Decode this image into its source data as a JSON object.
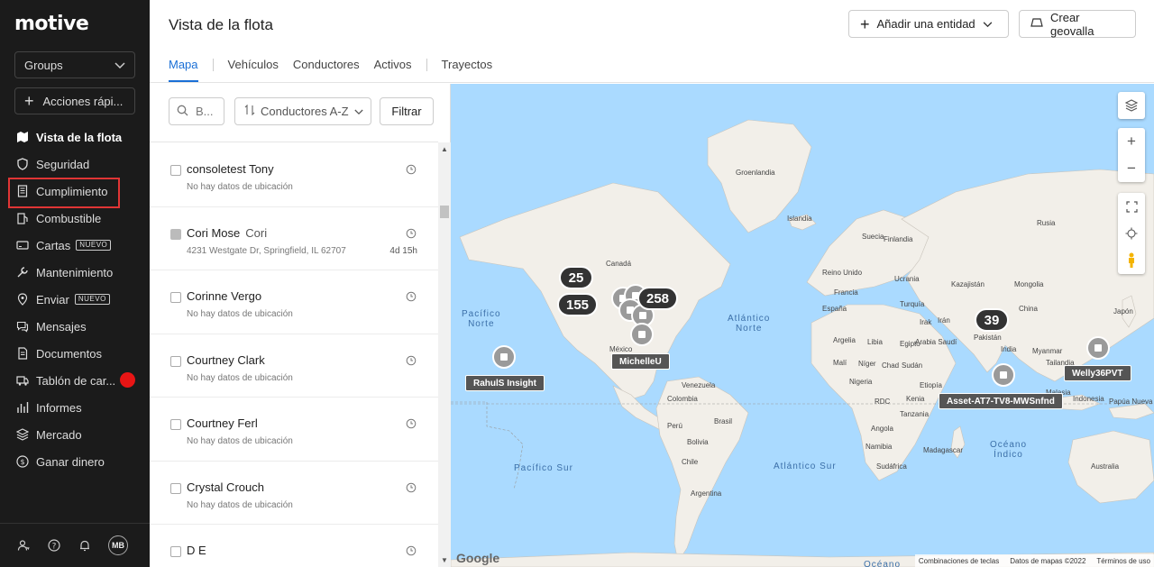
{
  "app": {
    "logo": "motive"
  },
  "sidebar": {
    "groups_label": "Groups",
    "quick_actions_label": "Acciones rápi...",
    "new_badge": "NUEVO",
    "items": [
      {
        "label": "Vista de la flota",
        "icon": "map-icon"
      },
      {
        "label": "Seguridad",
        "icon": "shield-icon"
      },
      {
        "label": "Cumplimiento",
        "icon": "document-icon"
      },
      {
        "label": "Combustible",
        "icon": "fuel-icon"
      },
      {
        "label": "Cartas",
        "icon": "card-icon"
      },
      {
        "label": "Mantenimiento",
        "icon": "wrench-icon"
      },
      {
        "label": "Enviar",
        "icon": "dispatch-icon"
      },
      {
        "label": "Mensajes",
        "icon": "messages-icon"
      },
      {
        "label": "Documentos",
        "icon": "documents-icon"
      },
      {
        "label": "Tablón de car...",
        "icon": "load-board-icon"
      },
      {
        "label": "Informes",
        "icon": "reports-icon"
      },
      {
        "label": "Mercado",
        "icon": "marketplace-icon"
      },
      {
        "label": "Ganar dinero",
        "icon": "money-icon"
      }
    ],
    "avatar_initials": "MB"
  },
  "header": {
    "title": "Vista de la flota",
    "add_entity_label": "Añadir una entidad",
    "create_geofence_label": "Crear geovalla",
    "tabs": [
      "Mapa",
      "Vehículos",
      "Conductores",
      "Activos",
      "Trayectos"
    ]
  },
  "list_toolbar": {
    "search_placeholder": "B...",
    "sort_label": "Conductores A-Z",
    "filter_label": "Filtrar"
  },
  "drivers": [
    {
      "name": "consoletest Tony",
      "sub": "",
      "location": "No hay datos de ubicación",
      "time": ""
    },
    {
      "name": "Cori Mose",
      "sub": "Cori",
      "location": "4231 Westgate Dr, Springfield, IL 62707",
      "time": "4d 15h"
    },
    {
      "name": "Corinne Vergo",
      "sub": "",
      "location": "No hay datos de ubicación",
      "time": ""
    },
    {
      "name": "Courtney Clark",
      "sub": "",
      "location": "No hay datos de ubicación",
      "time": ""
    },
    {
      "name": "Courtney Ferl",
      "sub": "",
      "location": "No hay datos de ubicación",
      "time": ""
    },
    {
      "name": "Crystal Crouch",
      "sub": "",
      "location": "No hay datos de ubicación",
      "time": ""
    },
    {
      "name": "D E",
      "sub": "",
      "location": "",
      "time": ""
    }
  ],
  "map": {
    "clusters": [
      "25",
      "155",
      "258",
      "39"
    ],
    "vehicle_tags": [
      "RahulS Insight",
      "MichelleU",
      "Asset-AT7-TV8-MWSnfnd",
      "Welly36PVT"
    ],
    "labels": {
      "groenlandia": "Groenlandia",
      "islandia": "Islandia",
      "canada": "Canadá",
      "mexico": "México",
      "venezuela": "Venezuela",
      "colombia": "Colombia",
      "peru": "Perú",
      "brasil": "Brasil",
      "bolivia": "Bolivia",
      "chile": "Chile",
      "argentina": "Argentina",
      "argelia": "Argelia",
      "libia": "Libia",
      "egipto": "Egipto",
      "mali": "Malí",
      "niger": "Níger",
      "chad": "Chad",
      "sudan": "Sudán",
      "etiopia": "Etiopía",
      "nigeria": "Nigeria",
      "rdc": "RDC",
      "kenia": "Kenia",
      "tanzania": "Tanzania",
      "angola": "Angola",
      "namibia": "Namibia",
      "sudafrica": "Sudáfrica",
      "madagascar": "Madagascar",
      "suecia": "Suecia",
      "finlandia": "Finlandia",
      "reino_unido": "Reino Unido",
      "ucrania": "Ucrania",
      "francia": "Francia",
      "espana": "España",
      "turquia": "Turquía",
      "iran": "Irán",
      "irak": "Irak",
      "arabia": "Arabia Saudí",
      "kazajistan": "Kazajistán",
      "mongolia": "Mongolia",
      "china": "China",
      "pakistan": "Pakistán",
      "india": "India",
      "myanmar": "Myanmar",
      "tailandia": "Tailandia",
      "rusia": "Rusia",
      "japon": "Japón",
      "malasia": "Malasia",
      "indonesia": "Indonesia",
      "papua": "Papúa Nueva Guinea",
      "australia": "Australia"
    },
    "oceans": {
      "pacifico_norte": "Pacífico\nNorte",
      "atlantico_norte": "Atlántico\nNorte",
      "pacifico_sur": "Pacífico Sur",
      "atlantico_sur": "Atlántico Sur",
      "oceano_indico": "Océano\nÍndico",
      "oceano_bottom": "Océano"
    },
    "attribution": [
      "Combinaciones de teclas",
      "Datos de mapas ©2022",
      "Términos de uso"
    ],
    "google_logo": "Google"
  },
  "colors": {
    "accent": "#1a6fd6",
    "sidebar_bg": "#1b1b1b",
    "ocean": "#aadaff",
    "land": "#f2efe9",
    "highlight": "#e03535"
  }
}
